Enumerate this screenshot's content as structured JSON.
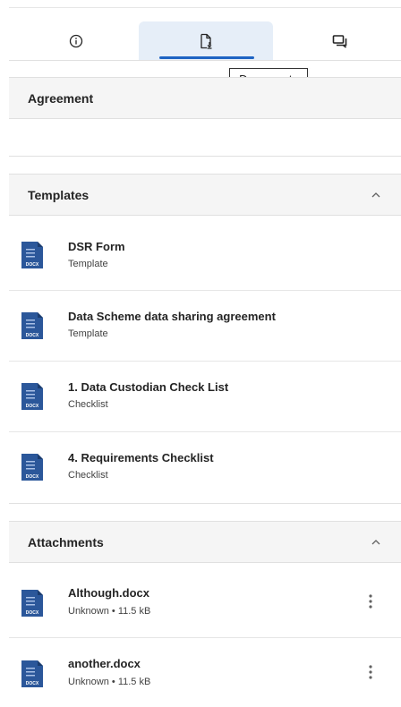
{
  "tabs": [
    {
      "id": "info",
      "icon": "info-icon"
    },
    {
      "id": "documents",
      "icon": "document-icon",
      "active": true,
      "tooltip": "Documents"
    },
    {
      "id": "chat",
      "icon": "chat-icon"
    }
  ],
  "sections": {
    "agreement": {
      "title": "Agreement"
    },
    "templates": {
      "title": "Templates",
      "items": [
        {
          "name": "DSR Form",
          "sub": "Template",
          "badge": "DOCX"
        },
        {
          "name": "Data Scheme data sharing agreement",
          "sub": "Template",
          "badge": "DOCX"
        },
        {
          "name": "1. Data Custodian Check List",
          "sub": "Checklist",
          "badge": "DOCX"
        },
        {
          "name": "4. Requirements Checklist",
          "sub": "Checklist",
          "badge": "DOCX"
        }
      ]
    },
    "attachments": {
      "title": "Attachments",
      "items": [
        {
          "name": "Although.docx",
          "sub": "Unknown • 11.5 kB",
          "badge": "DOCX"
        },
        {
          "name": "another.docx",
          "sub": "Unknown • 11.5 kB",
          "badge": "DOCX"
        }
      ]
    }
  },
  "colors": {
    "accent": "#1e63c3",
    "doc_icon": "#2b579a",
    "header_bg": "#f5f5f5"
  }
}
